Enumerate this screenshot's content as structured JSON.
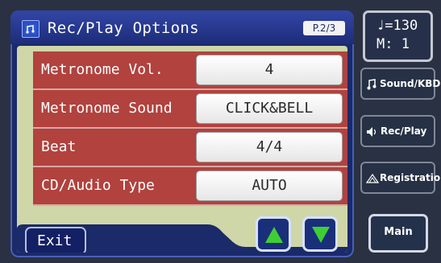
{
  "title": "Rec/Play Options",
  "page_indicator": "P.2/3",
  "rows": [
    {
      "label": "Metronome Vol.",
      "value": "4"
    },
    {
      "label": "Metronome Sound",
      "value": "CLICK&BELL"
    },
    {
      "label": "Beat",
      "value": "4/4"
    },
    {
      "label": "CD/Audio Type",
      "value": "AUTO"
    }
  ],
  "exit_label": "Exit",
  "tempo": {
    "line1": "♩=130",
    "line2": "M:   1"
  },
  "side_buttons": {
    "sound_kbd": "Sound/KBD",
    "rec_play": "Rec/Play",
    "registration": "Registration",
    "main": "Main"
  },
  "icons": {
    "title": "keyboard-note-icon",
    "up": "up-arrow-icon",
    "down": "down-arrow-icon",
    "sound": "music-note-icon",
    "rec": "speaker-icon",
    "registration": "registration-icon"
  },
  "colors": {
    "panel": "#1a2a6b",
    "row": "#b1423e",
    "content": "#cfd6a8",
    "arrow": "#3fcf34"
  }
}
